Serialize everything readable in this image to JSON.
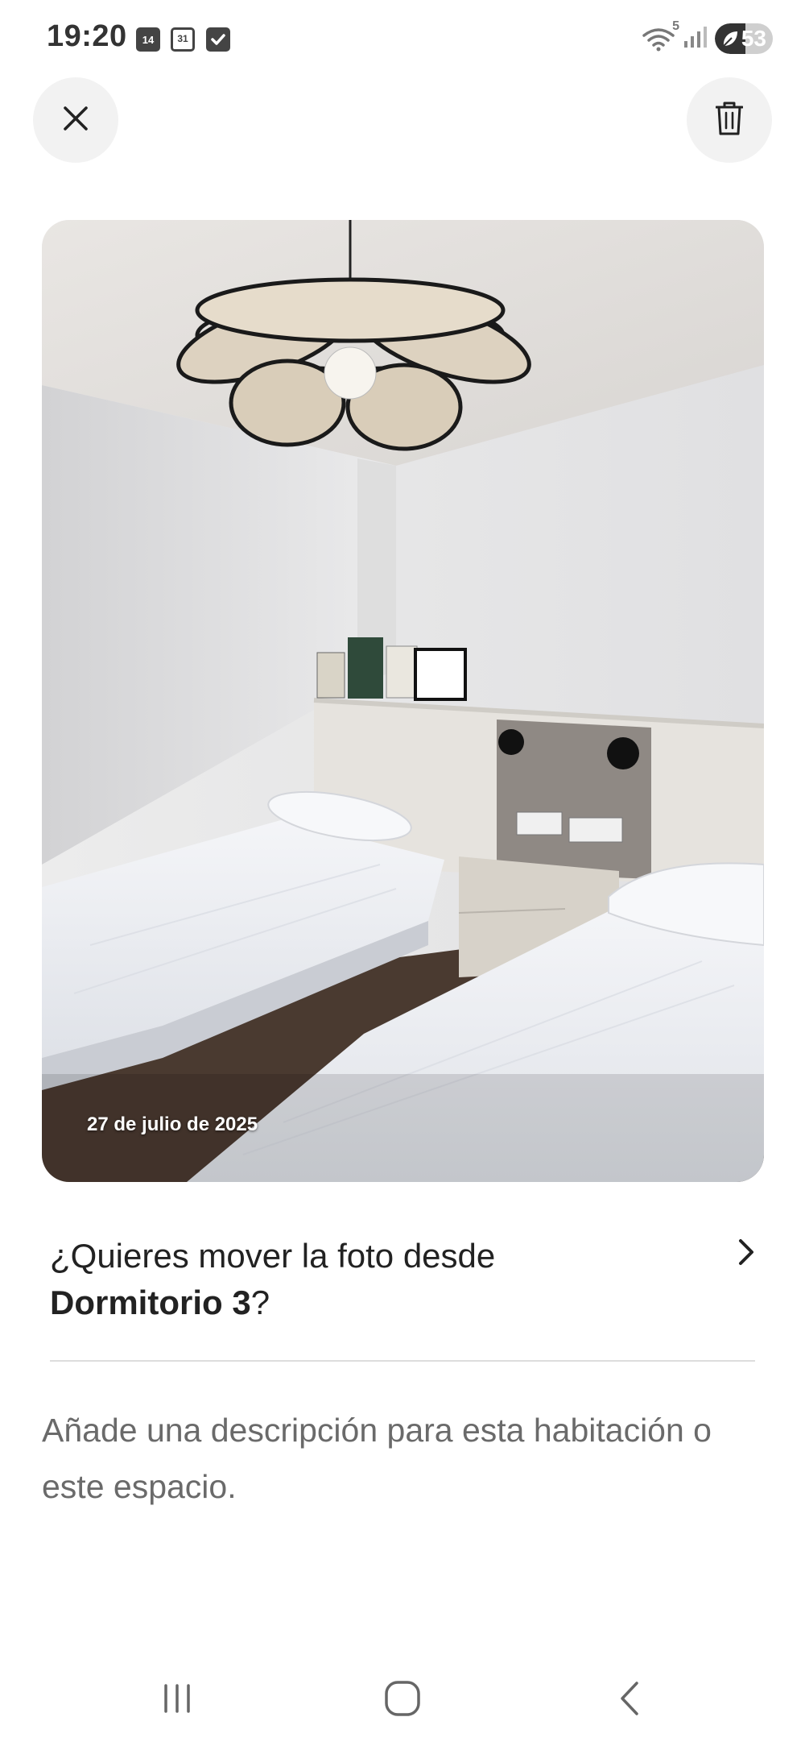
{
  "status_bar": {
    "time": "19:20",
    "notification_icons": [
      "calendar-14-icon",
      "calendar-31-icon",
      "checkbox-icon"
    ],
    "calendar_day_1": "14",
    "calendar_day_2": "31",
    "wifi_label": "5",
    "battery_percent": "53"
  },
  "header": {
    "close_icon": "close-icon",
    "delete_icon": "trash-icon"
  },
  "photo": {
    "date": "27 de julio de 2025"
  },
  "move": {
    "prefix": "¿Quieres mover la foto desde ",
    "room": "Dormitorio 3",
    "suffix": "?"
  },
  "description": {
    "placeholder": "Añade una descripción para esta habitación o este espacio."
  },
  "nav_bar": {
    "icons": [
      "recent-apps-icon",
      "home-icon",
      "back-icon"
    ]
  },
  "colors": {
    "button_bg": "#f2f2f2",
    "text_primary": "#222222",
    "text_secondary": "#6a6a6a",
    "divider": "#dddddd"
  }
}
